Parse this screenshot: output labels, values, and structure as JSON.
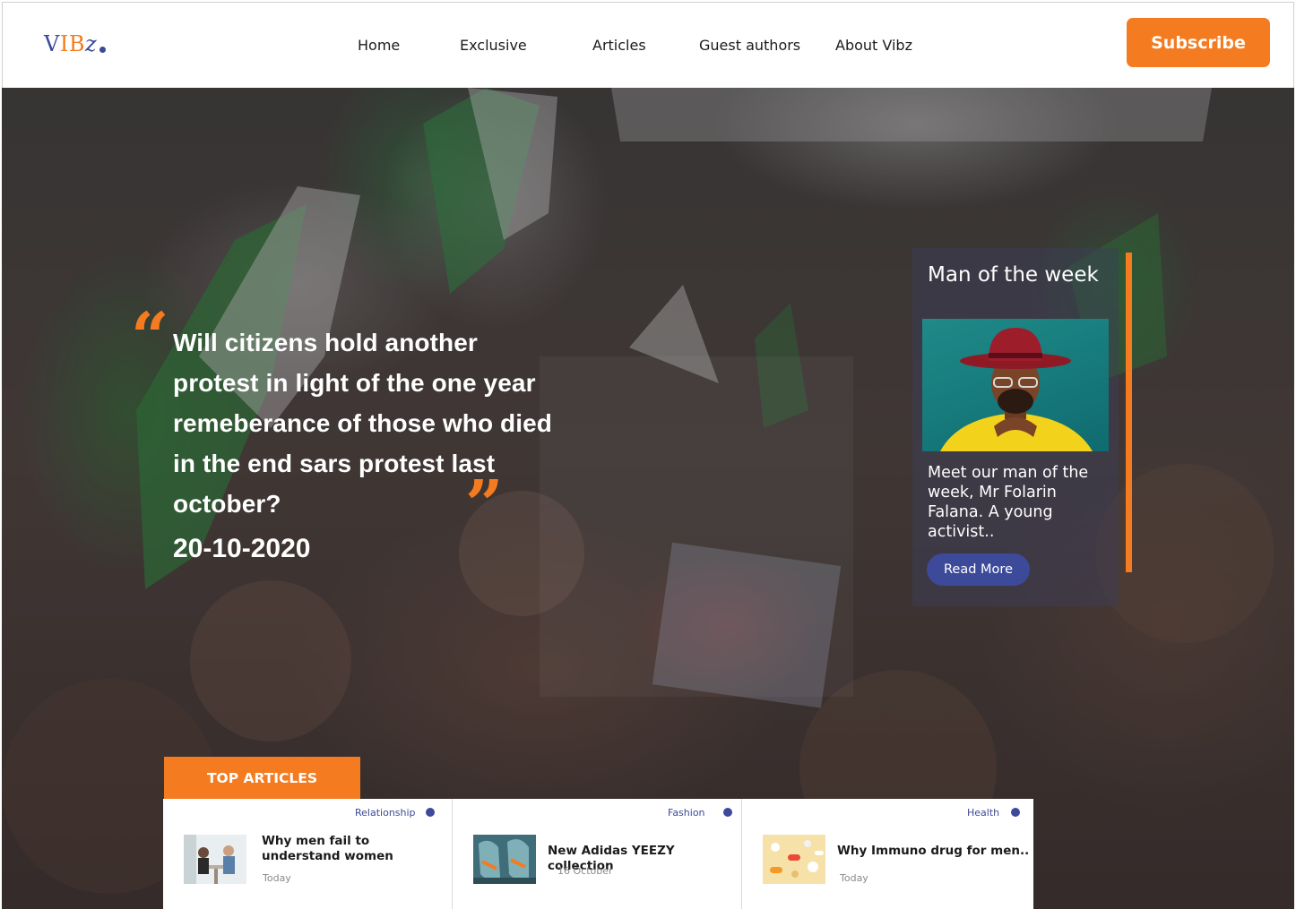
{
  "header": {
    "logo": {
      "v": "V",
      "ib": "IB",
      "z": "z"
    },
    "nav": [
      "Home",
      "Exclusive",
      "Articles",
      "Guest authors",
      "About Vibz"
    ],
    "subscribe_label": "Subscribe"
  },
  "hero": {
    "headline": "Will citizens hold another protest in light of the one year remeberance of those who died in the end sars protest last october?",
    "date": "20-10-2020",
    "quote_open": "“",
    "quote_close": "”"
  },
  "man_of_week": {
    "title": "Man of the week",
    "text": "Meet our man of the week, Mr Folarin Falana. A young activist..",
    "read_more_label": "Read More"
  },
  "top_articles": {
    "tab_label": "TOP ARTICLES",
    "items": [
      {
        "category": "Relationship",
        "title": "Why men fail to understand women",
        "time": "Today"
      },
      {
        "category": "Fashion",
        "title": "New Adidas YEEZY collection",
        "time": "16 October"
      },
      {
        "category": "Health",
        "title": "Why Immuno drug for men..",
        "time": "Today"
      }
    ]
  },
  "colors": {
    "accent": "#f47b20",
    "brand": "#3d4a9a"
  }
}
